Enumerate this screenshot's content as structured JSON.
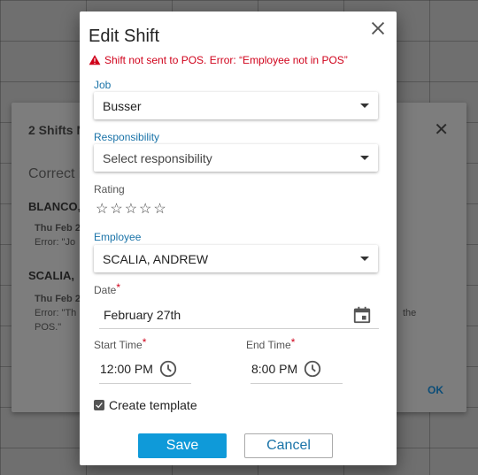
{
  "background_dialog": {
    "title": "2 Shifts N",
    "correct_text": "Correct i",
    "entries": [
      {
        "name": "BLANCO,",
        "date": "Thu Feb 2",
        "error": "Error: \"Jo"
      },
      {
        "name": "SCALIA, ",
        "date": "Thu Feb 2",
        "error_line1": "Error: \"Th",
        "error_line2": "POS.\""
      }
    ],
    "right_text": "the",
    "ok_label": "OK"
  },
  "dialog": {
    "title": "Edit Shift",
    "error_message": "Shift not sent to POS. Error: “Employee not in POS”",
    "job": {
      "label": "Job",
      "value": "Busser"
    },
    "responsibility": {
      "label": "Responsibility",
      "placeholder": "Select responsibility"
    },
    "rating": {
      "label": "Rating",
      "stars_total": 5,
      "stars_filled": 0,
      "star_glyph": "☆"
    },
    "employee": {
      "label": "Employee",
      "value": "SCALIA, ANDREW"
    },
    "date": {
      "label": "Date",
      "required": "*",
      "value": "February 27th"
    },
    "start_time": {
      "label": "Start Time",
      "required": "*",
      "value": "12:00 PM"
    },
    "end_time": {
      "label": "End Time",
      "required": "*",
      "value": "8:00 PM"
    },
    "create_template": {
      "label": "Create template",
      "checked": true
    },
    "save_label": "Save",
    "cancel_label": "Cancel"
  },
  "colors": {
    "accent": "#0f9ad9",
    "label_blue": "#1a73a8",
    "error_red": "#d0021b"
  }
}
